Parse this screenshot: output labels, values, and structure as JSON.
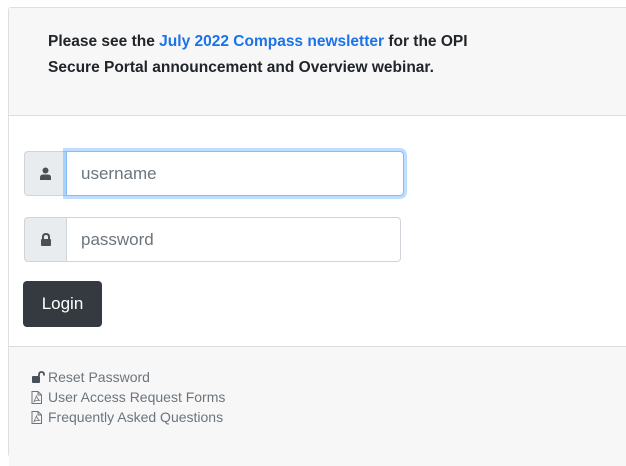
{
  "announcement": {
    "line1_before": "Please see the ",
    "line1_link": "July 2022 Compass newsletter",
    "line1_after": " for the OPI",
    "line2": "Secure Portal announcement and Overview webinar."
  },
  "login_form": {
    "username": {
      "placeholder": "username",
      "value": "",
      "icon": "user-icon"
    },
    "password": {
      "placeholder": "password",
      "value": "",
      "icon": "lock-icon"
    },
    "login_label": "Login"
  },
  "footer_links": [
    {
      "label": "Reset Password",
      "icon": "unlock-icon"
    },
    {
      "label": "User Access Request Forms",
      "icon": "pdf-file-icon"
    },
    {
      "label": "Frequently Asked Questions",
      "icon": "pdf-file-icon"
    }
  ],
  "colors": {
    "link": "#1a73e8",
    "button": "#343a40",
    "addon_bg": "#e9ecef",
    "header_bg": "#f7f7f7",
    "focus_border": "#80bdff"
  }
}
